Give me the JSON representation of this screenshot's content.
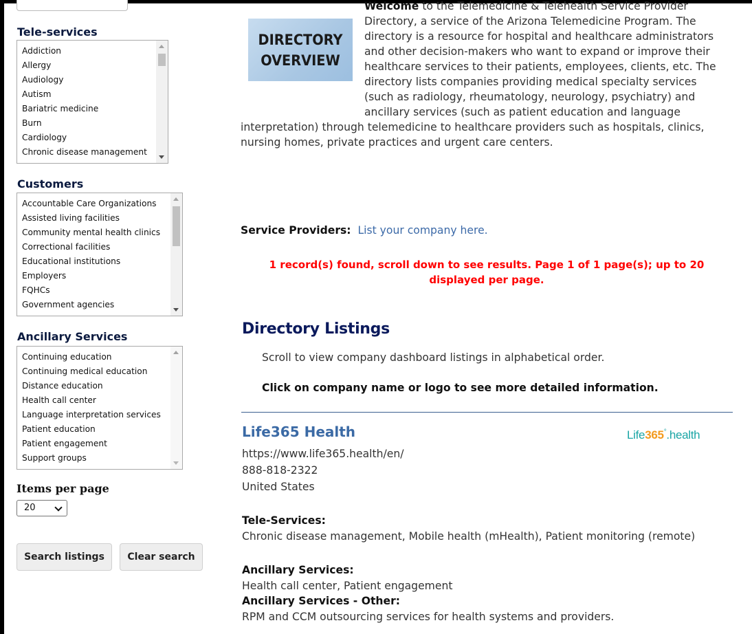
{
  "sidebar": {
    "teleservices": {
      "heading": "Tele-services",
      "items": [
        "Addiction",
        "Allergy",
        "Audiology",
        "Autism",
        "Bariatric medicine",
        "Burn",
        "Cardiology",
        "Chronic disease management"
      ]
    },
    "customers": {
      "heading": "Customers",
      "items": [
        "Accountable Care Organizations",
        "Assisted living facilities",
        "Community mental health clinics",
        "Correctional facilities",
        "Educational institutions",
        "Employers",
        "FQHCs",
        "Government agencies"
      ]
    },
    "ancillary": {
      "heading": "Ancillary Services",
      "items": [
        "Continuing education",
        "Continuing medical education",
        "Distance education",
        "Health call center",
        "Language interpretation services",
        "Patient education",
        "Patient engagement",
        "Support groups"
      ]
    },
    "items_per_page": {
      "label": "Items per page",
      "value": "20"
    },
    "search_button": "Search listings",
    "clear_button": "Clear search"
  },
  "intro": {
    "image_line1": "DIRECTORY",
    "image_line2": "OVERVIEW",
    "welcome_bold": "Welcome",
    "welcome_text": " to the Telemedicine & Telehealth Service Provider Directory, a service of the Arizona Telemedicine Program. The directory is a resource for hospital and healthcare administrators and other decision-makers who want to expand or improve their healthcare services to their patients, employees, clients, etc. The directory lists companies providing medical specialty services (such as radiology, rheumatology, neurology, psychiatry) and ancillary services (such as patient education and language interpretation) through telemedicine to healthcare providers such as hospitals, clinics, nursing homes, private practices and urgent care centers."
  },
  "service_providers": {
    "label": "Service Providers:",
    "link": "List your company here."
  },
  "records_notice": "1 record(s) found, scroll down to see results. Page 1 of 1 page(s); up to 20 displayed per page.",
  "directory": {
    "title": "Directory Listings",
    "subtitle": "Scroll to view company dashboard listings in alphabetical order.",
    "click_note": "Click on company name or logo to see more detailed information."
  },
  "listing": {
    "name": "Life365 Health",
    "logo_left": "Life",
    "logo_mid": "365",
    "logo_deg": "°",
    "logo_right": ".health",
    "url": "https://www.life365.health/en/",
    "phone": "888-818-2322",
    "country": "United States",
    "tele_services_label": "Tele-Services:",
    "tele_services": "Chronic disease management, Mobile health (mHealth), Patient monitoring (remote)",
    "ancillary_label": "Ancillary Services:",
    "ancillary": "Health call center, Patient engagement",
    "ancillary_other_label": "Ancillary Services - Other:",
    "ancillary_other": "RPM and CCM outsourcing services for health systems and providers."
  },
  "colors": {
    "heading_navy": "#0b1a5c",
    "link_blue": "#3c6aa8",
    "notice_red": "#ff0000",
    "logo_teal": "#1aa5a5",
    "logo_orange": "#f39a1e"
  }
}
